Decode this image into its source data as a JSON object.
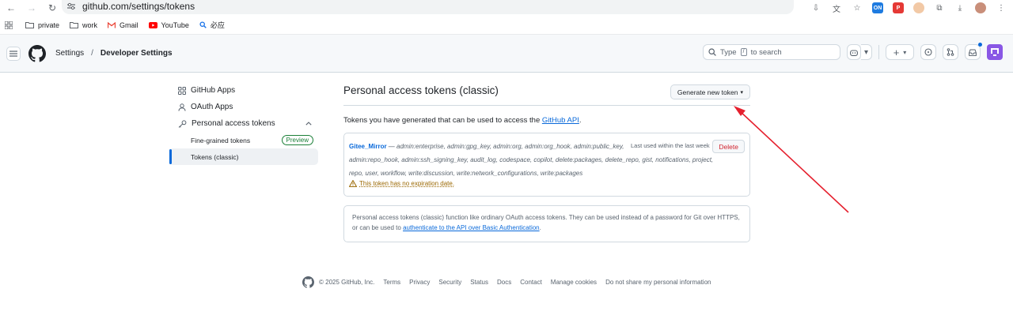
{
  "browser": {
    "url": "github.com/settings/tokens",
    "bookmarks": [
      "private",
      "work",
      "Gmail",
      "YouTube",
      "必应"
    ]
  },
  "header": {
    "breadcrumb_root": "Settings",
    "breadcrumb_sep": "/",
    "breadcrumb_current": "Developer Settings",
    "search_before": "Type",
    "search_key": "/",
    "search_after": "to search"
  },
  "sidebar": {
    "github_apps": "GitHub Apps",
    "oauth_apps": "OAuth Apps",
    "personal_tokens": "Personal access tokens",
    "fine_grained": "Fine-grained tokens",
    "preview_badge": "Preview",
    "tokens_classic": "Tokens (classic)"
  },
  "main": {
    "title": "Personal access tokens (classic)",
    "generate_button": "Generate new token",
    "intro_text": "Tokens you have generated that can be used to access the",
    "intro_link": "GitHub API",
    "intro_end": ".",
    "token": {
      "name": "Gitee_Mirror",
      "scopes_line1": " — admin:enterprise, admin:gpg_key, admin:org, admin:org_hook, admin:public_key,",
      "scopes_line2": "admin:repo_hook, admin:ssh_signing_key, audit_log, codespace, copilot, delete:packages, delete_repo, gist, notifications, project,",
      "scopes_line3": "repo, user, workflow, write:discussion, write:network_configurations, write:packages",
      "last_used": "Last used within the last week",
      "delete_button": "Delete",
      "warning": "This token has no expiration date."
    },
    "info_text": "Personal access tokens (classic) function like ordinary OAuth access tokens. They can be used instead of a password for Git over HTTPS, or can be used to",
    "info_link": "authenticate to the API over Basic Authentication",
    "info_end": "."
  },
  "footer": {
    "copyright": "© 2025 GitHub, Inc.",
    "links": [
      "Terms",
      "Privacy",
      "Security",
      "Status",
      "Docs",
      "Contact",
      "Manage cookies",
      "Do not share my personal information"
    ]
  },
  "colors": {
    "link": "#0969da",
    "danger": "#d1242f",
    "warning": "#9a6700",
    "annotation_arrow": "#e5202e"
  }
}
